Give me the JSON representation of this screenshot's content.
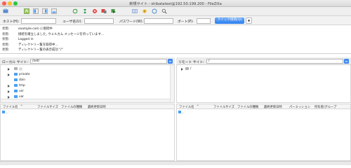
{
  "window": {
    "title": "新規サイト - shibatatest@192.50.199.200 - FileZilla",
    "traffic_light_colors": [
      "#fc5f57",
      "#fdbc2e",
      "#29c840"
    ]
  },
  "toolbar": {
    "icons": [
      "site-manager-icon",
      "toggle-log-icon",
      "toggle-local-tree-icon",
      "toggle-remote-tree-icon",
      "refresh-icon",
      "process-queue-icon",
      "cancel-icon",
      "disconnect-icon",
      "reconnect-icon",
      "filter-icon",
      "compare-icon",
      "sync-browse-icon",
      "search-icon"
    ]
  },
  "quickconnect": {
    "host_label": "ホスト(H):",
    "host_value": "",
    "user_label": "ユーザ名(U):",
    "user_value": "",
    "password_label": "パスワード(W):",
    "password_value": "",
    "port_label": "ポート(P):",
    "port_value": "",
    "button_label": "クイック接続(Q)",
    "dropdown_glyph": "▼"
  },
  "log": [
    {
      "label": "状態:",
      "text": "example.com に接続中"
    },
    {
      "label": "状態:",
      "text": "接続を確立しました, ウェルカム メッセージを待っています..."
    },
    {
      "label": "状態:",
      "text": "Logged in"
    },
    {
      "label": "状態:",
      "text": "ディレクトリー覧を取得中..."
    },
    {
      "label": "状態:",
      "text": "ディレクトリー覧の表示成功 \"/\""
    }
  ],
  "local": {
    "site_label": "ローカル サイト:",
    "site_path": "/net/",
    "tree": [
      {
        "name": ".."
      },
      {
        "name": "private"
      },
      {
        "name": "sbin"
      },
      {
        "name": "tmp"
      },
      {
        "name": "usr"
      },
      {
        "name": "var"
      }
    ],
    "columns": [
      "ファイル名",
      "ファイルサイズ",
      "ファイルの種類",
      "最終更新日時"
    ],
    "sort_glyph": "^",
    "rows": [
      ".."
    ]
  },
  "remote": {
    "site_label": "リモート サイト:",
    "site_path": "/",
    "tree": [
      {
        "name": "/"
      }
    ],
    "columns": [
      "ファイル名",
      "ファイルサイズ",
      "ファイルの種類",
      "最終更新日時",
      "パーミッション",
      "所有者/グループ"
    ],
    "sort_glyph": "^",
    "rows": [
      ".."
    ]
  }
}
